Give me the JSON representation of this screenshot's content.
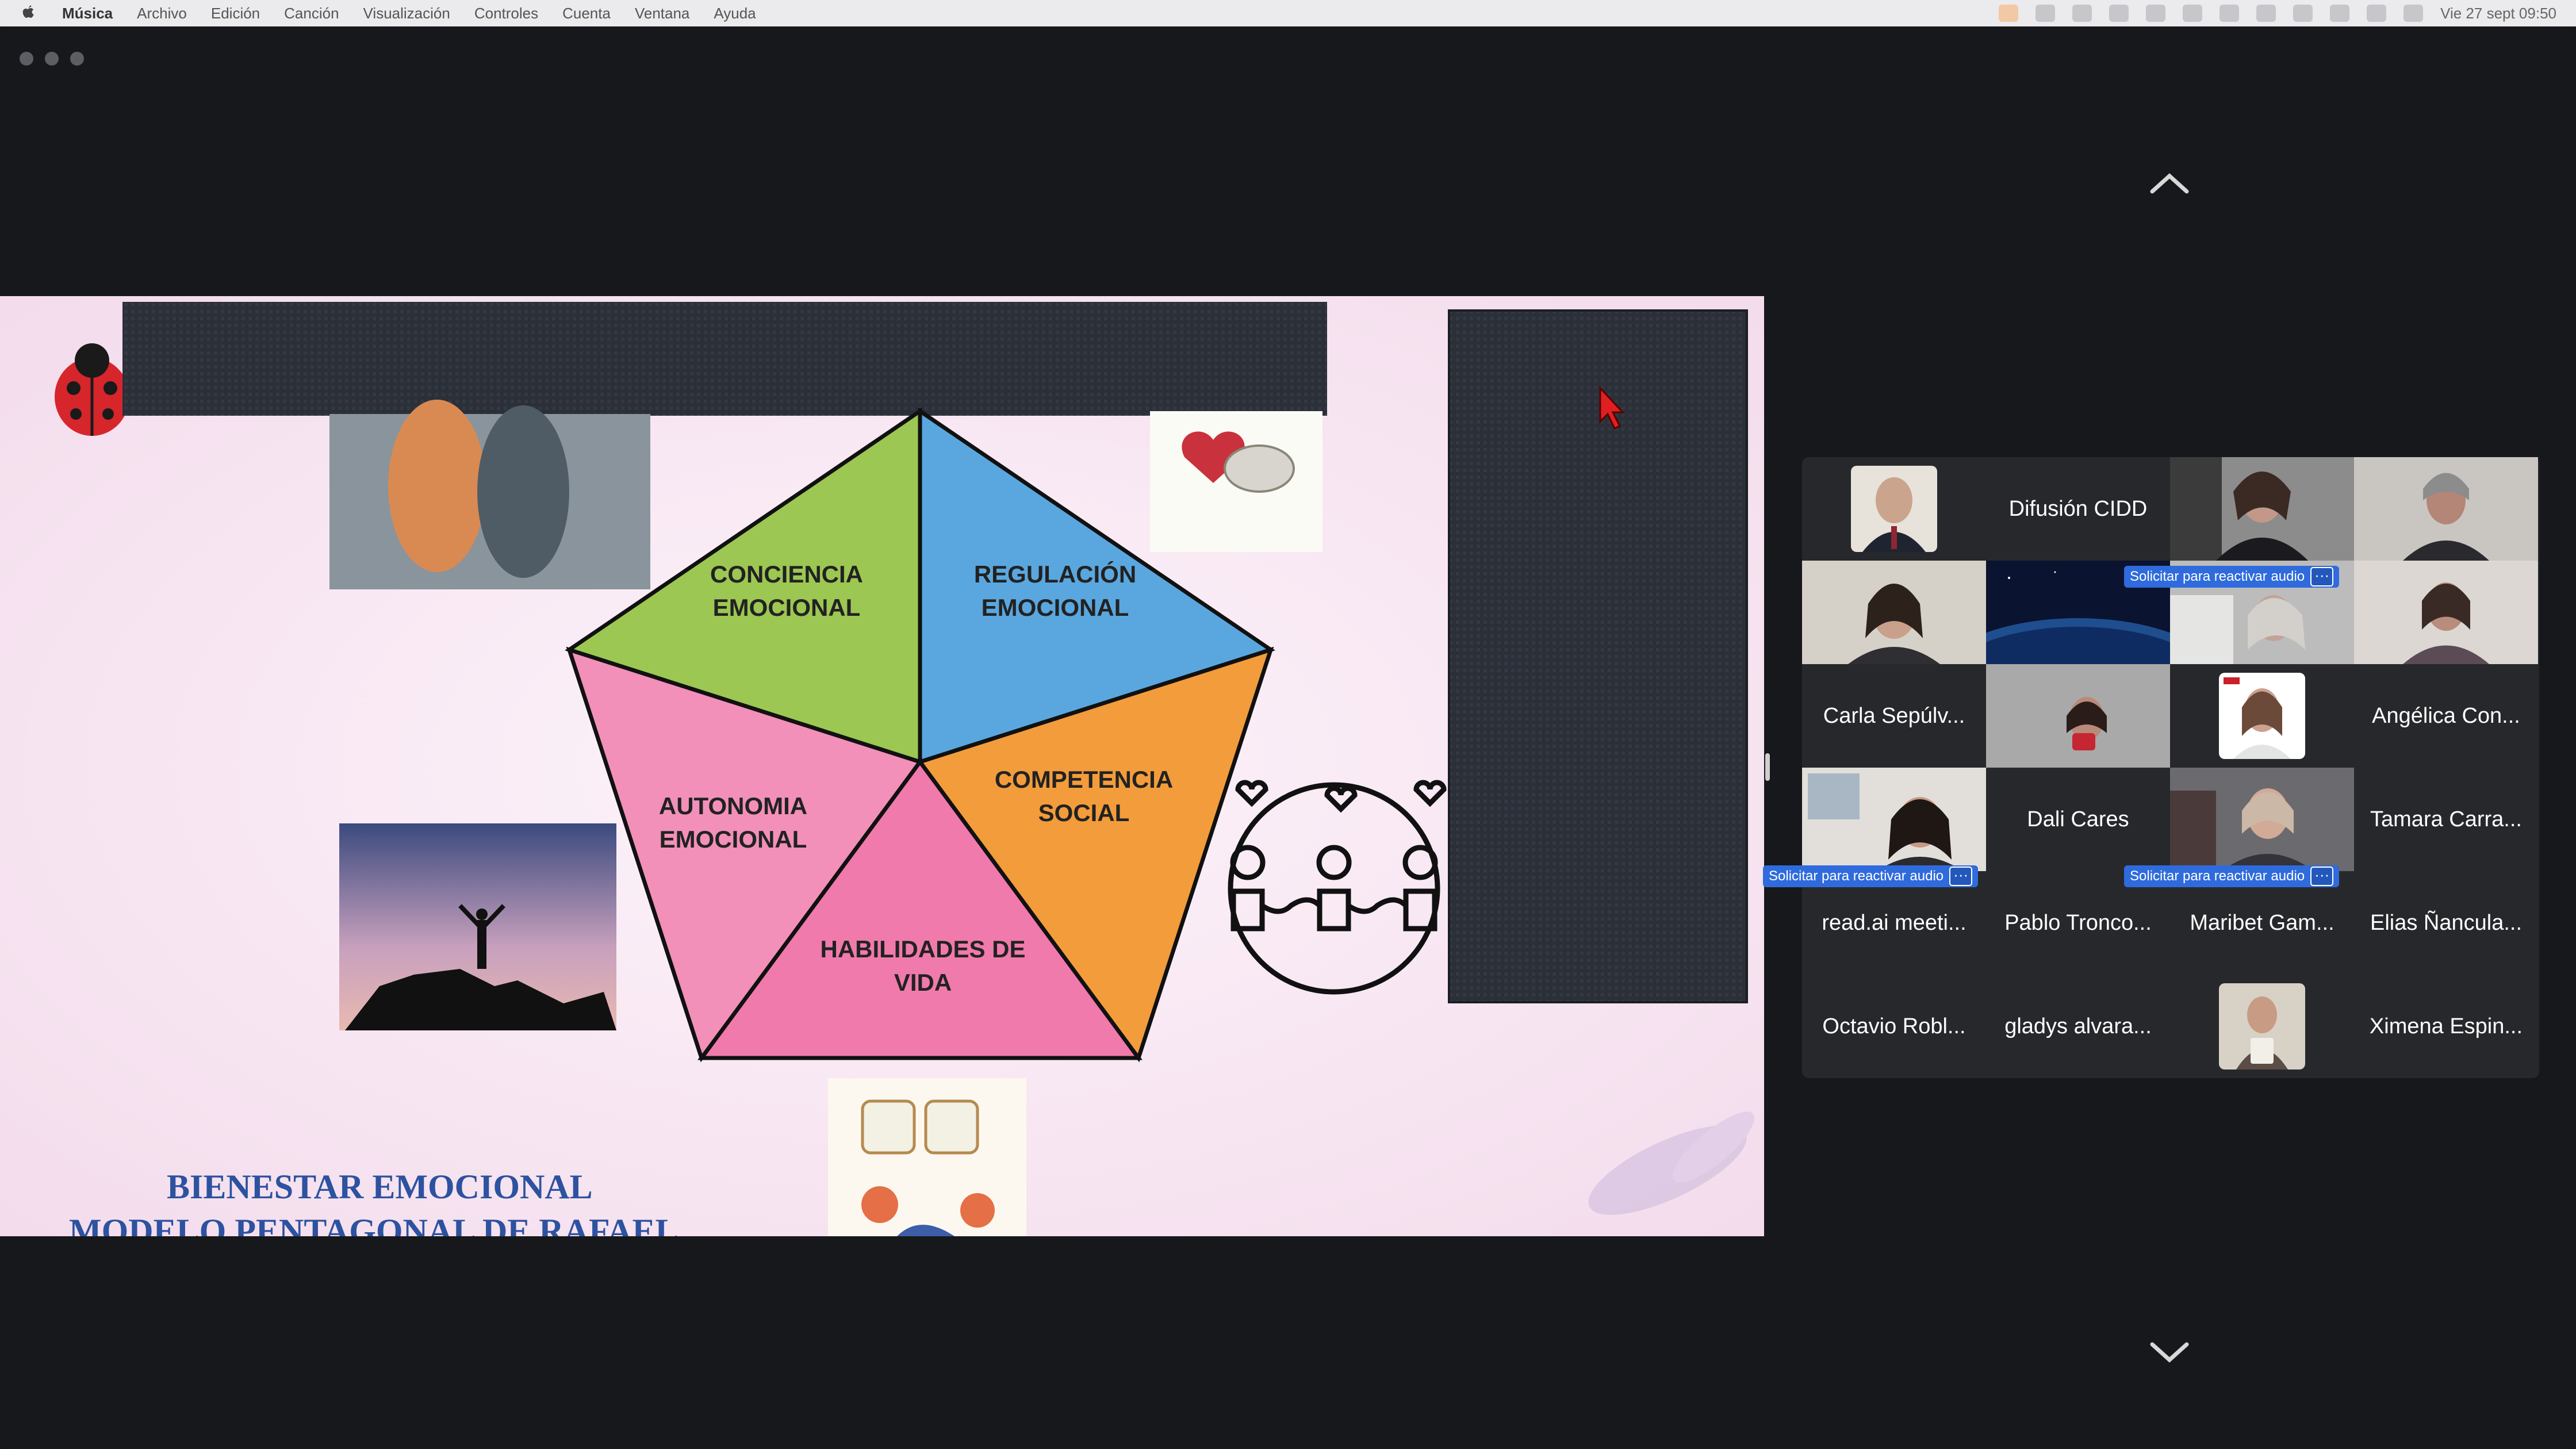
{
  "menubar": {
    "app_name": "Música",
    "items": [
      "Archivo",
      "Edición",
      "Canción",
      "Visualización",
      "Controles",
      "Cuenta",
      "Ventana",
      "Ayuda"
    ],
    "clock": "Vie 27 sept  09:50"
  },
  "slide": {
    "segments": [
      "CONCIENCIA EMOCIONAL",
      "REGULACIÓN EMOCIONAL",
      "COMPETENCIA SOCIAL",
      "HABILIDADES DE VIDA",
      "AUTONOMIA EMOCIONAL"
    ],
    "colors": {
      "conciencia": "#9cc752",
      "regulacion": "#5aa7df",
      "competencia": "#f39c3b",
      "habilidades": "#f07aab",
      "autonomia": "#f290b9"
    },
    "title_line1": "BIENESTAR EMOCIONAL",
    "title_line2": "MODELO PENTAGONAL DE RAFAEL"
  },
  "gallery": {
    "reactivate_label": "Solicitar para reactivar audio",
    "more_label": "···",
    "participants": [
      {
        "name": "Difusión CIDD",
        "type": "name"
      },
      {
        "name": "Carla Sepúlv...",
        "type": "name"
      },
      {
        "name": "Angélica Con...",
        "type": "name"
      },
      {
        "name": "Dali Cares",
        "type": "name"
      },
      {
        "name": "Tamara Carra...",
        "type": "name"
      },
      {
        "name": "read.ai meeti...",
        "type": "name"
      },
      {
        "name": "Pablo Tronco...",
        "type": "name"
      },
      {
        "name": "Maribet Gam...",
        "type": "name"
      },
      {
        "name": "Elias Ñancula...",
        "type": "name"
      },
      {
        "name": "Octavio Robl...",
        "type": "name"
      },
      {
        "name": "gladys alvara...",
        "type": "name"
      },
      {
        "name": "Ximena Espin...",
        "type": "name"
      }
    ]
  }
}
